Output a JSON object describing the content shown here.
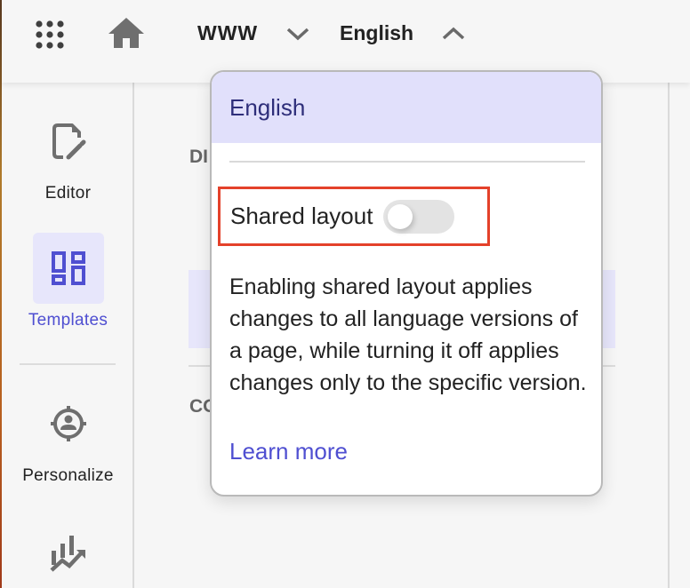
{
  "topbar": {
    "apps_icon": "apps-grid-icon",
    "home_icon": "home-icon",
    "site_selector": {
      "label": "WWW",
      "icon": "chevron-down-icon"
    },
    "language_selector": {
      "label": "English",
      "icon": "chevron-up-icon"
    }
  },
  "sidenav": {
    "items": [
      {
        "label": "Editor",
        "icon": "edit-document-icon",
        "active": false
      },
      {
        "label": "Templates",
        "icon": "dashboard-layout-icon",
        "active": true
      },
      {
        "label": "Personalize",
        "icon": "target-person-icon",
        "active": false
      },
      {
        "label": "",
        "icon": "analytics-chart-icon",
        "active": false
      }
    ]
  },
  "content": {
    "section_heads": [
      "DI",
      "CO"
    ]
  },
  "popover": {
    "selected_language": "English",
    "shared_layout": {
      "label": "Shared layout",
      "enabled": false
    },
    "description": "Enabling shared layout applies changes to all language versions of a page, while turning it off applies changes only to the specific version.",
    "learn_more_label": "Learn more"
  },
  "colors": {
    "accent": "#4f4fd1",
    "header_bg": "#e1e0fb",
    "active_nav_bg": "#e7e6fb",
    "highlight_border": "#e4412a",
    "background": "#f6f6f6"
  }
}
